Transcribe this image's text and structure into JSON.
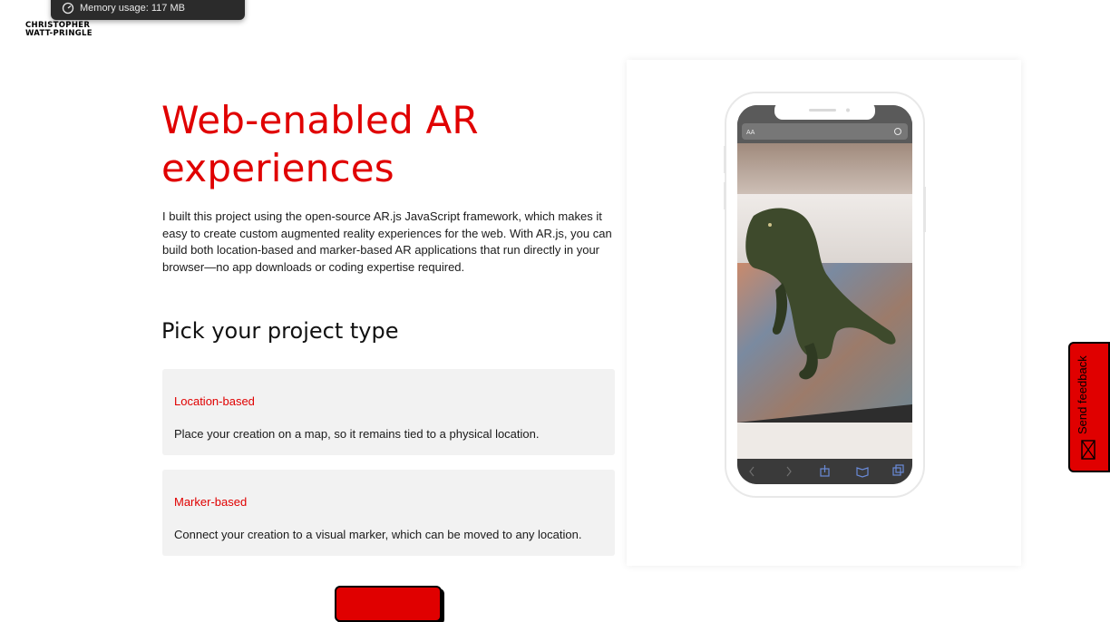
{
  "tooltip": {
    "icon": "gauge-icon",
    "text": "Memory usage: 117 MB"
  },
  "logo": {
    "line1": "CHRISTOPHER",
    "line2": "WATT-PRINGLE"
  },
  "hero": {
    "title_line1": "Web-enabled AR",
    "title_line2": "experiences",
    "intro": "I built this project using the open-source AR.js JavaScript framework, which makes it easy to create custom augmented reality experiences for the web. With AR.js, you can build both location-based and marker-based AR applications that run directly in your browser—no app downloads or coding expertise required."
  },
  "picker": {
    "heading": "Pick your project type",
    "options": [
      {
        "title": "Location-based",
        "description": "Place your creation on a map, so it remains tied to a physical location."
      },
      {
        "title": "Marker-based",
        "description": "Connect your creation to a visual marker, which can be moved to any location."
      }
    ]
  },
  "phone": {
    "address_bar": "AA",
    "toolbar_icons": [
      "back-icon",
      "forward-icon",
      "share-icon",
      "bookmarks-icon",
      "tabs-icon"
    ]
  },
  "feedback": {
    "label": "Send feedback",
    "icon": "mail-icon"
  },
  "colors": {
    "accent": "#e00000",
    "card_bg": "#f2f2f2",
    "text": "#1a1a1a"
  }
}
